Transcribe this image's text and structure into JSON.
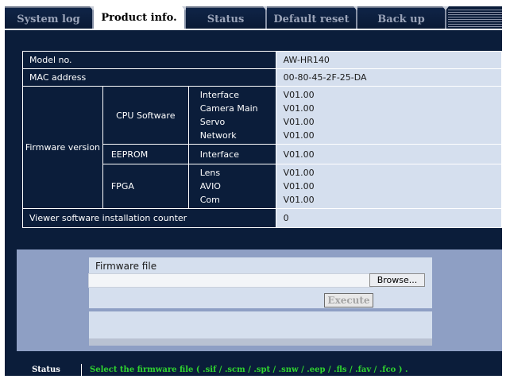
{
  "tabs": [
    {
      "label": "System log",
      "active": false
    },
    {
      "label": "Product info.",
      "active": true
    },
    {
      "label": "Status",
      "active": false
    },
    {
      "label": "Default reset",
      "active": false
    },
    {
      "label": "Back up",
      "active": false
    }
  ],
  "product": {
    "model_label": "Model no.",
    "model_value": "AW-HR140",
    "mac_label": "MAC address",
    "mac_value": "00-80-45-2F-25-DA",
    "firmware_label": "Firmware version",
    "cpu": {
      "label": "CPU Software",
      "items": [
        "Interface",
        "Camera Main",
        "Servo",
        "Network"
      ],
      "values": [
        "V01.00",
        "V01.00",
        "V01.00",
        "V01.00"
      ]
    },
    "eeprom": {
      "label": "EEPROM",
      "item": "Interface",
      "value": "V01.00"
    },
    "fpga": {
      "label": "FPGA",
      "items": [
        "Lens",
        "AVIO",
        "Com"
      ],
      "values": [
        "V01.00",
        "V01.00",
        "V01.00"
      ]
    },
    "counter_label": "Viewer software installation counter",
    "counter_value": "0"
  },
  "upload": {
    "title": "Firmware file",
    "file_value": "",
    "browse_label": "Browse...",
    "execute_label": "Execute"
  },
  "status": {
    "label": "Status",
    "message": "Select the firmware file ( .sif / .scm / .spt / .snw / .eep / .fls / .fav / .fco ) ."
  },
  "colors": {
    "background": "#0b1d3a",
    "value_cell": "#d5dfee",
    "panel": "#8e9fc4",
    "status_text": "#2fd42f"
  }
}
